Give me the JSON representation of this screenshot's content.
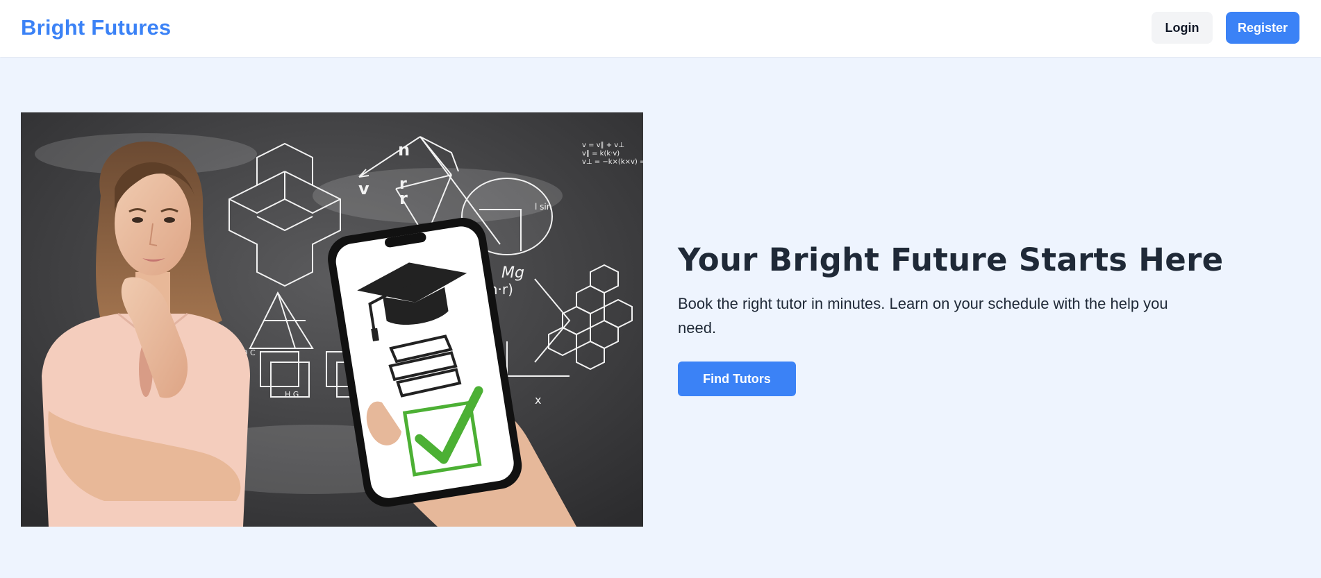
{
  "header": {
    "brand": "Bright Futures",
    "login_label": "Login",
    "register_label": "Register"
  },
  "hero": {
    "headline": "Your Bright Future Starts Here",
    "subtext": "Book the right tutor in minutes. Learn on your schedule with the help you need.",
    "cta_label": "Find Tutors"
  },
  "colors": {
    "accent": "#3b82f6",
    "page_background": "#eef4fe",
    "heading_text": "#1f2937",
    "check_green": "#4cb034"
  },
  "icons": {
    "graduation_cap": "graduation-cap-icon",
    "books": "books-icon",
    "checkmark": "checkmark-icon"
  }
}
